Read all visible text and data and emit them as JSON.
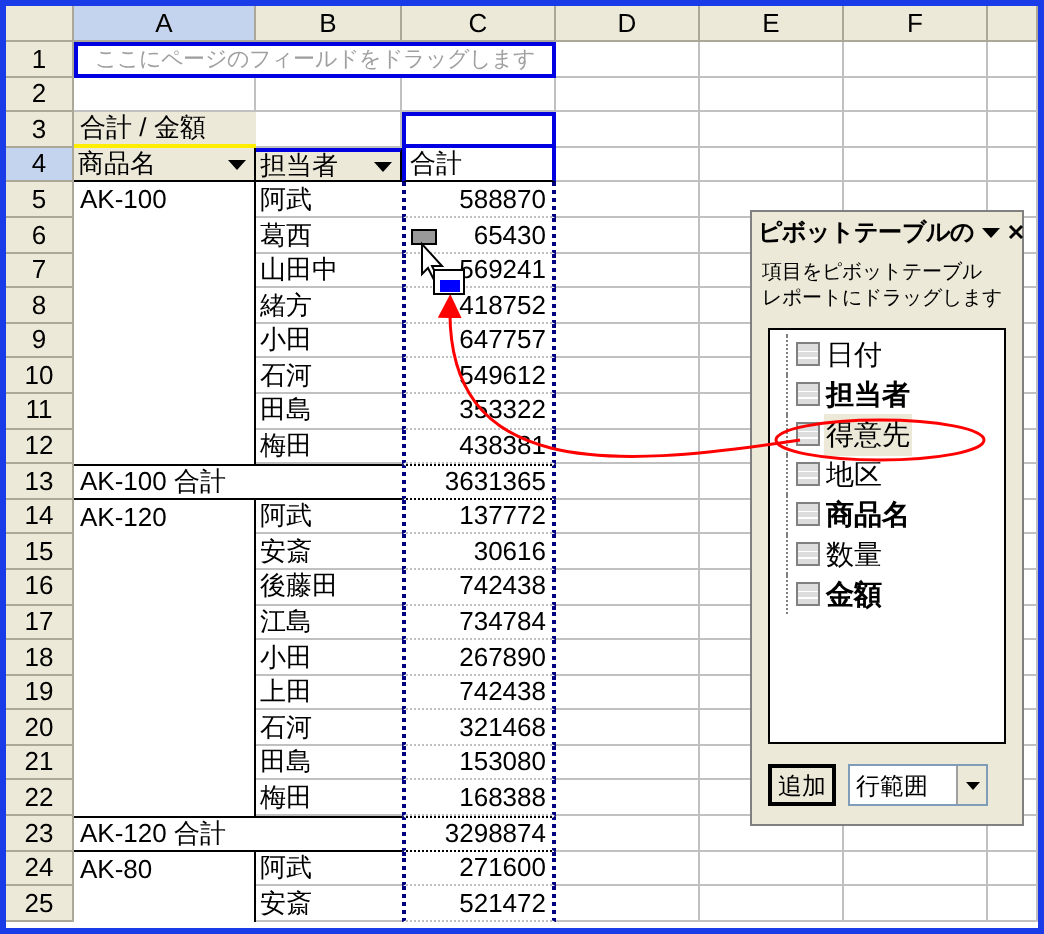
{
  "columns": [
    {
      "label": "A",
      "selected": true
    },
    {
      "label": "B",
      "selected": false
    },
    {
      "label": "C",
      "selected": false
    },
    {
      "label": "D",
      "selected": false
    },
    {
      "label": "E",
      "selected": false
    },
    {
      "label": "F",
      "selected": false
    }
  ],
  "rows": [
    {
      "number": "1",
      "kind": "page_area",
      "selected": false,
      "placeholder": "ここにページのフィールドをドラッグします"
    },
    {
      "number": "2",
      "kind": "blank",
      "selected": false
    },
    {
      "number": "3",
      "kind": "data_label",
      "selected": false,
      "label": "合計 / 金額"
    },
    {
      "number": "4",
      "kind": "field_headers",
      "selected": true,
      "fields": [
        "商品名",
        "担当者"
      ],
      "total": "合計"
    },
    {
      "number": "5",
      "kind": "item",
      "selected": false,
      "product": "AK-100",
      "person": "阿武",
      "total": "588870"
    },
    {
      "number": "6",
      "kind": "item",
      "selected": false,
      "person": "葛西",
      "total": "65430"
    },
    {
      "number": "7",
      "kind": "item",
      "selected": false,
      "person": "山田中",
      "total": "569241"
    },
    {
      "number": "8",
      "kind": "item",
      "selected": false,
      "person": "緒方",
      "total": "418752"
    },
    {
      "number": "9",
      "kind": "item",
      "selected": false,
      "person": "小田",
      "total": "647757"
    },
    {
      "number": "10",
      "kind": "item",
      "selected": false,
      "person": "石河",
      "total": "549612"
    },
    {
      "number": "11",
      "kind": "item",
      "selected": false,
      "person": "田島",
      "total": "353322"
    },
    {
      "number": "12",
      "kind": "item",
      "selected": false,
      "person": "梅田",
      "total": "438381"
    },
    {
      "number": "13",
      "kind": "subtotal",
      "selected": false,
      "label": "AK-100 合計",
      "total": "3631365"
    },
    {
      "number": "14",
      "kind": "item",
      "selected": false,
      "product": "AK-120",
      "person": "阿武",
      "total": "137772"
    },
    {
      "number": "15",
      "kind": "item",
      "selected": false,
      "person": "安斎",
      "total": "30616"
    },
    {
      "number": "16",
      "kind": "item",
      "selected": false,
      "person": "後藤田",
      "total": "742438"
    },
    {
      "number": "17",
      "kind": "item",
      "selected": false,
      "person": "江島",
      "total": "734784"
    },
    {
      "number": "18",
      "kind": "item",
      "selected": false,
      "person": "小田",
      "total": "267890"
    },
    {
      "number": "19",
      "kind": "item",
      "selected": false,
      "person": "上田",
      "total": "742438"
    },
    {
      "number": "20",
      "kind": "item",
      "selected": false,
      "person": "石河",
      "total": "321468"
    },
    {
      "number": "21",
      "kind": "item",
      "selected": false,
      "person": "田島",
      "total": "153080"
    },
    {
      "number": "22",
      "kind": "item",
      "selected": false,
      "person": "梅田",
      "total": "168388"
    },
    {
      "number": "23",
      "kind": "subtotal",
      "selected": false,
      "label": "AK-120 合計",
      "total": "3298874"
    },
    {
      "number": "24",
      "kind": "item",
      "selected": false,
      "product": "AK-80",
      "person": "阿武",
      "total": "271600"
    },
    {
      "number": "25",
      "kind": "item",
      "selected": false,
      "person": "安斎",
      "total": "521472"
    }
  ],
  "field_list": {
    "title": "ピボットテーブルの",
    "instructions": [
      "項目をピボットテーブル",
      "レポートにドラッグします"
    ],
    "fields": [
      {
        "name": "日付",
        "bold": false,
        "selected": false
      },
      {
        "name": "担当者",
        "bold": true,
        "selected": false
      },
      {
        "name": "得意先",
        "bold": false,
        "selected": true
      },
      {
        "name": "地区",
        "bold": false,
        "selected": false
      },
      {
        "name": "商品名",
        "bold": true,
        "selected": false
      },
      {
        "name": "数量",
        "bold": false,
        "selected": false
      },
      {
        "name": "金額",
        "bold": true,
        "selected": false
      }
    ],
    "add_button": "追加",
    "area": "行範囲"
  }
}
